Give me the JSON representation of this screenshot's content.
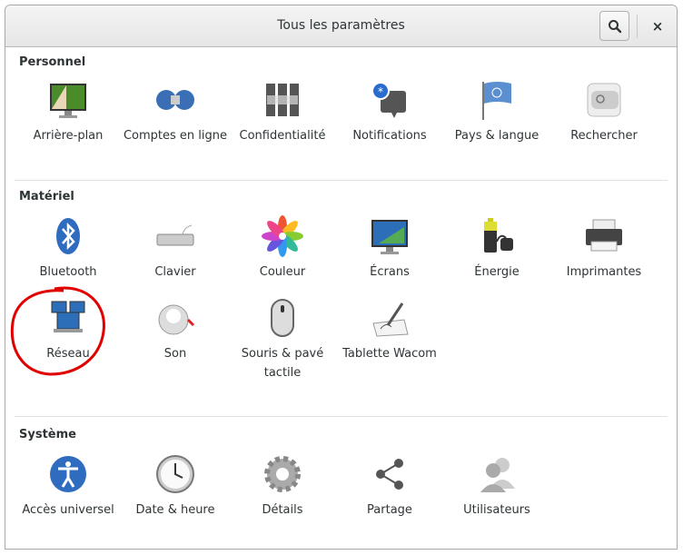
{
  "header": {
    "title": "Tous les paramètres",
    "search_icon": "search-icon",
    "close_label": "×"
  },
  "sections": [
    {
      "title": "Personnel",
      "items": [
        {
          "label": "Arrière-plan",
          "icon": "background-icon"
        },
        {
          "label": "Comptes en ligne",
          "icon": "online-accounts-icon"
        },
        {
          "label": "Confidentialité",
          "icon": "privacy-icon"
        },
        {
          "label": "Notifications",
          "icon": "notifications-icon"
        },
        {
          "label": "Pays & langue",
          "icon": "region-flag-icon"
        },
        {
          "label": "Rechercher",
          "icon": "search-settings-icon"
        }
      ]
    },
    {
      "title": "Matériel",
      "items": [
        {
          "label": "Bluetooth",
          "icon": "bluetooth-icon"
        },
        {
          "label": "Clavier",
          "icon": "keyboard-icon"
        },
        {
          "label": "Couleur",
          "icon": "color-icon"
        },
        {
          "label": "Écrans",
          "icon": "display-icon"
        },
        {
          "label": "Énergie",
          "icon": "power-icon"
        },
        {
          "label": "Imprimantes",
          "icon": "printer-icon"
        },
        {
          "label": "Réseau",
          "icon": "network-icon"
        },
        {
          "label": "Son",
          "icon": "sound-icon"
        },
        {
          "label": "Souris & pavé tactile",
          "icon": "mouse-icon"
        },
        {
          "label": "Tablette Wacom",
          "icon": "wacom-tablet-icon"
        }
      ]
    },
    {
      "title": "Système",
      "items": [
        {
          "label": "Accès universel",
          "icon": "accessibility-icon"
        },
        {
          "label": "Date & heure",
          "icon": "clock-icon"
        },
        {
          "label": "Détails",
          "icon": "gear-icon"
        },
        {
          "label": "Partage",
          "icon": "share-icon"
        },
        {
          "label": "Utilisateurs",
          "icon": "users-icon"
        }
      ]
    }
  ],
  "annotation": {
    "color": "#e00000",
    "target": "Réseau"
  }
}
